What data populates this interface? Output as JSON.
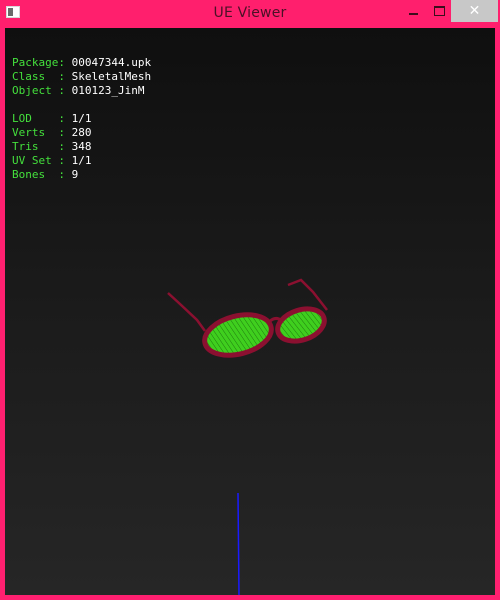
{
  "window": {
    "title": "UE Viewer",
    "controls": {
      "minimize": "minimize",
      "maximize": "maximize",
      "close": "✕"
    }
  },
  "info": {
    "package": {
      "key": "Package:",
      "value": "00047344.upk"
    },
    "class": {
      "key": "Class  :",
      "value": "SkeletalMesh"
    },
    "object": {
      "key": "Object :",
      "value": "010123_JinM"
    },
    "lod": {
      "key": "LOD    :",
      "value": "1/1"
    },
    "verts": {
      "key": "Verts  :",
      "value": "280"
    },
    "tris": {
      "key": "Tris   :",
      "value": "348"
    },
    "uvset": {
      "key": "UV Set :",
      "value": "1/1"
    },
    "bones": {
      "key": "Bones  :",
      "value": "9"
    }
  },
  "colors": {
    "border": "#ff2070",
    "label_green": "#44e03c",
    "frame": "#8b1030",
    "lens": "#3fcf1e",
    "axis": "#1a1aff"
  },
  "icons": {
    "app": "ue-viewer-app-icon"
  }
}
